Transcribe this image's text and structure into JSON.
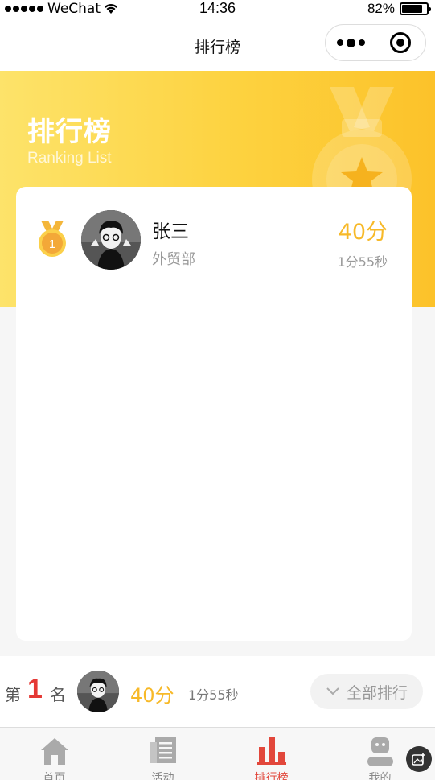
{
  "status_bar": {
    "carrier": "WeChat",
    "time": "14:36",
    "battery_percent": "82%",
    "battery_level": 0.82
  },
  "nav": {
    "title": "排行榜"
  },
  "hero": {
    "title": "排行榜",
    "subtitle": "Ranking List"
  },
  "ranking": [
    {
      "rank_badge": "1",
      "name": "张三",
      "department": "外贸部",
      "score": "40分",
      "time": "1分55秒"
    }
  ],
  "my_rank": {
    "prefix": "第",
    "rank": "1",
    "suffix": "名",
    "score": "40分",
    "time": "1分55秒",
    "all_button": "全部排行"
  },
  "tabs": [
    {
      "label": "首页",
      "icon": "home-icon"
    },
    {
      "label": "活动",
      "icon": "document-icon"
    },
    {
      "label": "排行榜",
      "icon": "bar-chart-icon",
      "active": true
    },
    {
      "label": "我的",
      "icon": "user-icon"
    }
  ],
  "colors": {
    "accent_yellow": "#fdd23f",
    "score_yellow": "#f7b928",
    "active_red": "#e2473b"
  }
}
